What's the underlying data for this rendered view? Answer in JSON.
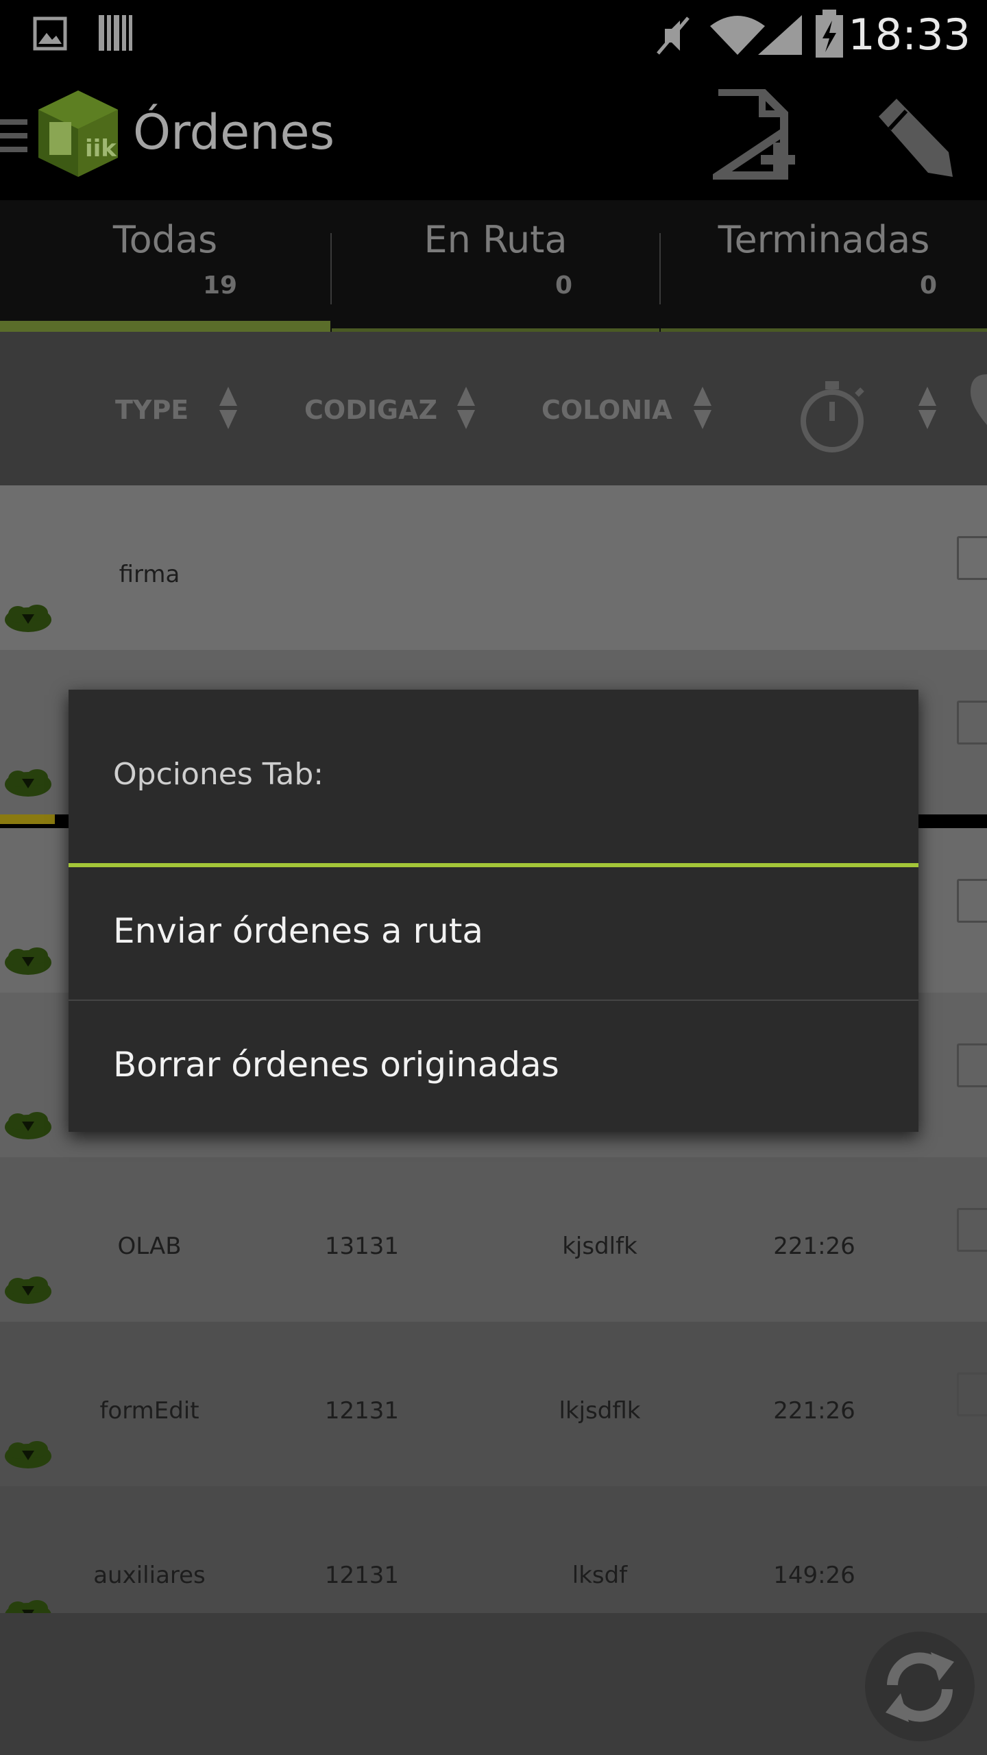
{
  "status_bar": {
    "time": "18:33"
  },
  "action_bar": {
    "title": "Órdenes",
    "new_order_icon": "new-document-icon",
    "edit_icon": "pencil-icon"
  },
  "tabs": [
    {
      "label": "Todas",
      "count": "19",
      "selected": true
    },
    {
      "label": "En Ruta",
      "count": "0",
      "selected": false
    },
    {
      "label": "Terminadas",
      "count": "0",
      "selected": false
    }
  ],
  "columns": {
    "type": "TYPE",
    "codigaz": "CODIGAZ",
    "colonia": "COLONIA"
  },
  "rows": [
    {
      "type": "firma",
      "codigaz": "",
      "colonia": "",
      "time": ""
    },
    {
      "type": "",
      "codigaz": "",
      "colonia": "",
      "time": ""
    },
    {
      "type": "",
      "codigaz": "",
      "colonia": "",
      "time": ""
    },
    {
      "type": "",
      "codigaz": "",
      "colonia": "",
      "time": ""
    },
    {
      "type": "OLAB",
      "codigaz": "13131",
      "colonia": "kjsdlfk",
      "time": "221:26"
    },
    {
      "type": "formEdit",
      "codigaz": "12131",
      "colonia": "lkjsdflk",
      "time": "221:26"
    },
    {
      "type": "auxiliares",
      "codigaz": "12131",
      "colonia": "lksdf",
      "time": "149:26"
    }
  ],
  "dialog": {
    "title": "Opciones Tab:",
    "items": [
      "Enviar órdenes a ruta",
      "Borrar órdenes originadas"
    ]
  },
  "colors": {
    "accent": "#a4c639",
    "dialog_bg": "#2b2b2b"
  }
}
